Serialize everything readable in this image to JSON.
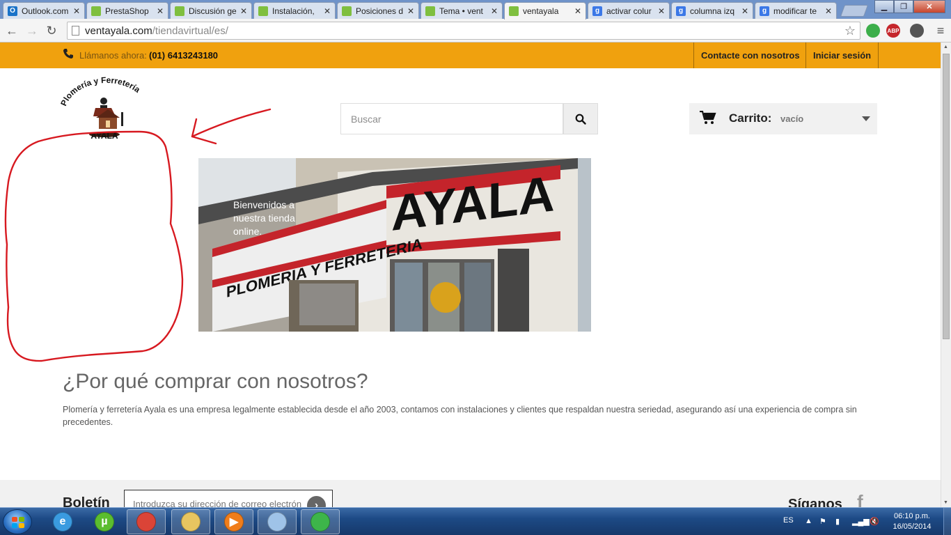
{
  "browser": {
    "tabs": [
      {
        "title": "Outlook.com",
        "favicon_color": "#1a73c8",
        "favicon_letter": "O"
      },
      {
        "title": "PrestaShop",
        "favicon_color": "#7fbf3f",
        "favicon_letter": ""
      },
      {
        "title": "Discusión ge",
        "favicon_color": "#7fbf3f",
        "favicon_letter": ""
      },
      {
        "title": "Instalación, ",
        "favicon_color": "#7fbf3f",
        "favicon_letter": ""
      },
      {
        "title": "Posiciones d",
        "favicon_color": "#7fbf3f",
        "favicon_letter": ""
      },
      {
        "title": "Tema • vent",
        "favicon_color": "#7fbf3f",
        "favicon_letter": ""
      },
      {
        "title": "ventayala",
        "favicon_color": "#7fbf3f",
        "favicon_letter": ""
      },
      {
        "title": "activar colur",
        "favicon_color": "#3b78e7",
        "favicon_letter": "g"
      },
      {
        "title": "columna izq",
        "favicon_color": "#3b78e7",
        "favicon_letter": "g"
      },
      {
        "title": "modificar te",
        "favicon_color": "#3b78e7",
        "favicon_letter": "g"
      }
    ],
    "active_tab": "ventayala",
    "close_glyph": "✕",
    "window_buttons": {
      "minimize": "▁",
      "maximize": "❐",
      "close": "✕"
    },
    "nav": {
      "back": "←",
      "forward": "→",
      "reload": "↻",
      "menu": "≡"
    },
    "url": {
      "host": "ventayala.com",
      "path": "/tiendavirtual/es/"
    },
    "bookmark_star": "☆",
    "extensions": [
      {
        "name": "green-ring-extension-icon",
        "label": "",
        "color": "#3cae4a"
      },
      {
        "name": "adblock-plus-icon",
        "label": "ABP",
        "color": "#c5262c"
      },
      {
        "name": "bug-extension-icon",
        "label": "",
        "color": "#555555"
      }
    ]
  },
  "store": {
    "topbar": {
      "phone_icon": "phone-icon",
      "call_label": "Llámanos ahora:",
      "call_number": "(01) 6413243180",
      "contact_link": "Contacte con nosotros",
      "login_link": "Iniciar sesión"
    },
    "logo": {
      "top_text": "Plomería y Ferretería",
      "bottom_text": "AYALA"
    },
    "search": {
      "placeholder": "Buscar"
    },
    "cart": {
      "title": "Carrito:",
      "status": "vacío"
    },
    "banner": {
      "caption": "Bienvenidos a nuestra tienda online.",
      "sign_text": "AYALA",
      "sign_subtext": "PLOMERIA Y FERRETERIA"
    },
    "why": {
      "title": "¿Por qué comprar con nosotros?",
      "text": "Plomería y ferretería Ayala es una empresa legalmente establecida desde el año 2003, contamos con instalaciones y clientes que respaldan nuestra seriedad, asegurando así una experiencia de compra sin precedentes."
    },
    "newsletter": {
      "title": "Boletín",
      "placeholder": "Introduzca su dirección de correo electrón"
    },
    "follow": {
      "title": "Síganos",
      "facebook": "f"
    }
  },
  "taskbar": {
    "items": [
      {
        "name": "internet-explorer-taskbar-icon",
        "glyph": "e",
        "color": "#3a9be0",
        "open": false
      },
      {
        "name": "utorrent-taskbar-icon",
        "glyph": "µ",
        "color": "#5bbd2f",
        "open": false
      },
      {
        "name": "chrome-taskbar-icon",
        "glyph": "",
        "color": "#db4437",
        "open": true
      },
      {
        "name": "file-explorer-taskbar-icon",
        "glyph": "",
        "color": "#e8c560",
        "open": true
      },
      {
        "name": "media-player-taskbar-icon",
        "glyph": "▶",
        "color": "#f07d1a",
        "open": true
      },
      {
        "name": "notepad-taskbar-icon",
        "glyph": "",
        "color": "#9fc3e8",
        "open": true
      },
      {
        "name": "installer-taskbar-icon",
        "glyph": "",
        "color": "#3db54a",
        "open": true
      }
    ],
    "language": "ES",
    "time": "06:10 p.m.",
    "date": "16/05/2014"
  }
}
